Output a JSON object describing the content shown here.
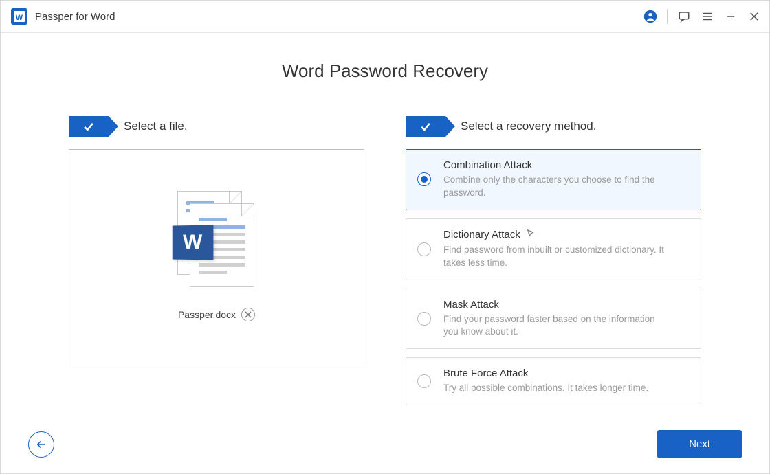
{
  "app": {
    "title": "Passper for Word"
  },
  "page": {
    "title": "Word Password Recovery"
  },
  "steps": {
    "file_label": "Select a file.",
    "method_label": "Select a recovery method."
  },
  "file": {
    "name": "Passper.docx"
  },
  "methods": [
    {
      "title": "Combination Attack",
      "desc": "Combine only the characters you choose to find the password.",
      "selected": true
    },
    {
      "title": "Dictionary Attack",
      "desc": "Find password from inbuilt or customized dictionary. It takes less time.",
      "selected": false,
      "cursor": true
    },
    {
      "title": "Mask Attack",
      "desc": "Find your password faster based on the information you know about it.",
      "selected": false
    },
    {
      "title": "Brute Force Attack",
      "desc": "Try all possible combinations. It takes longer time.",
      "selected": false
    }
  ],
  "footer": {
    "next_label": "Next"
  },
  "colors": {
    "brand": "#1862c6"
  }
}
